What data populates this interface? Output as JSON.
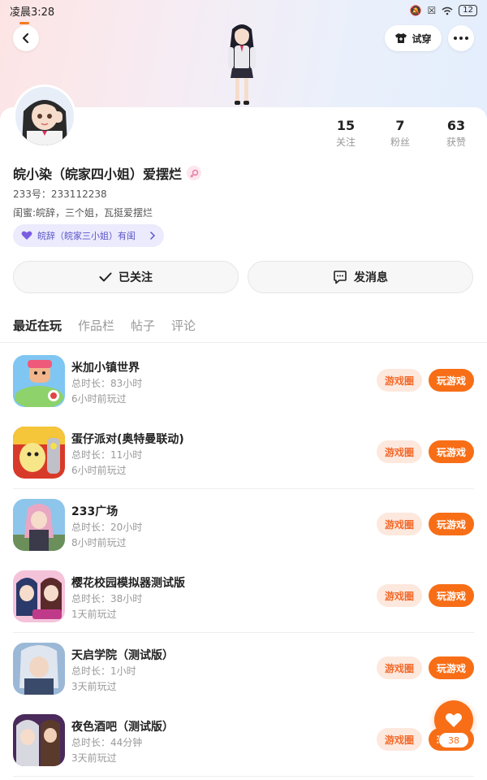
{
  "status_bar": {
    "time": "凌晨3:28",
    "battery": "12"
  },
  "header": {
    "tryon_label": "试穿"
  },
  "stats": [
    {
      "value": "15",
      "label": "关注"
    },
    {
      "value": "7",
      "label": "粉丝"
    },
    {
      "value": "63",
      "label": "获赞"
    }
  ],
  "profile": {
    "nickname": "皖小染（皖家四小姐）爱摆烂",
    "uid": "233号：233112238",
    "bio": "闺蜜:皖辞，三个姐，瓦挺爱摆烂",
    "bond": "皖辞（皖家三小姐）有闺"
  },
  "actions": {
    "follow_label": "已关注",
    "message_label": "发消息"
  },
  "tabs": [
    "最近在玩",
    "作品栏",
    "帖子",
    "评论"
  ],
  "games": [
    {
      "name": "米加小镇世界",
      "duration": "总时长：83小时",
      "last_played": "6小时前玩过",
      "circle_label": "游戏圈",
      "play_label": "玩游戏"
    },
    {
      "name": "蛋仔派对(奥特曼联动)",
      "duration": "总时长：11小时",
      "last_played": "6小时前玩过",
      "circle_label": "游戏圈",
      "play_label": "玩游戏"
    },
    {
      "name": "233广场",
      "duration": "总时长：20小时",
      "last_played": "8小时前玩过",
      "circle_label": "游戏圈",
      "play_label": "玩游戏"
    },
    {
      "name": "樱花校园模拟器测试版",
      "duration": "总时长：38小时",
      "last_played": "1天前玩过",
      "circle_label": "游戏圈",
      "play_label": "玩游戏"
    },
    {
      "name": "天启学院（测试版）",
      "duration": "总时长：1小时",
      "last_played": "3天前玩过",
      "circle_label": "游戏圈",
      "play_label": "玩游戏"
    },
    {
      "name": "夜色酒吧（测试版）",
      "duration": "总时长：44分钟",
      "last_played": "3天前玩过",
      "circle_label": "游戏圈",
      "play_label": "玩游戏"
    }
  ],
  "like": {
    "count": "38"
  },
  "colors": {
    "accent": "#f76e17",
    "accent_light": "#fde8de",
    "bond_bg": "#ecebfd"
  }
}
